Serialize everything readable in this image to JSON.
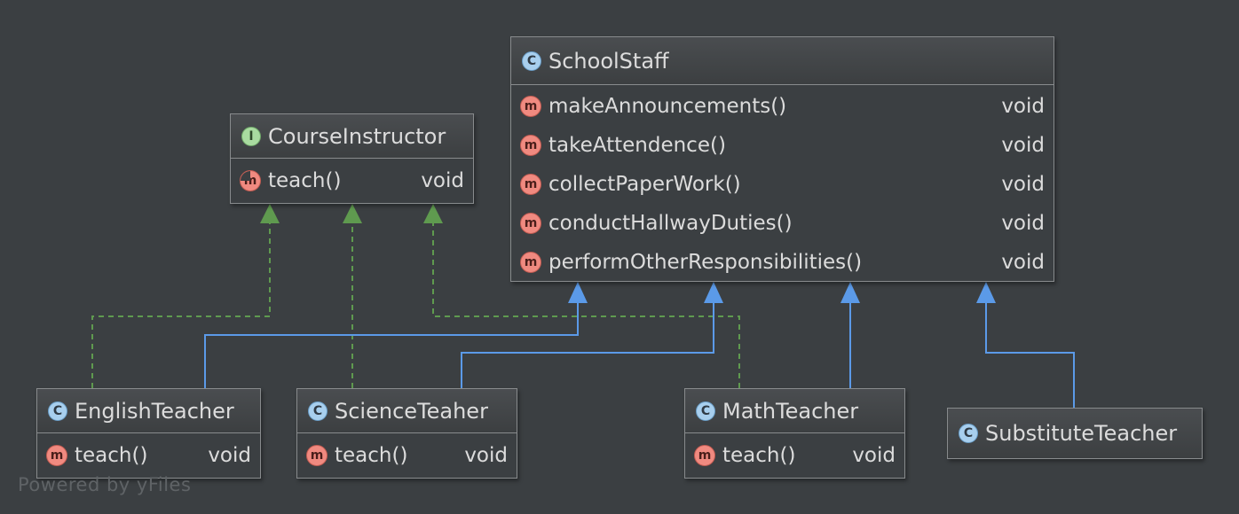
{
  "diagram": {
    "nodes": [
      {
        "id": "course-instructor",
        "kind": "interface",
        "badge": "I",
        "name": "CourseInstructor",
        "members": [
          {
            "badge": "m",
            "abstract": true,
            "name": "teach()",
            "type": "void"
          }
        ]
      },
      {
        "id": "school-staff",
        "kind": "class",
        "badge": "C",
        "name": "SchoolStaff",
        "members": [
          {
            "badge": "m",
            "name": "makeAnnouncements()",
            "type": "void"
          },
          {
            "badge": "m",
            "name": "takeAttendence()",
            "type": "void"
          },
          {
            "badge": "m",
            "name": "collectPaperWork()",
            "type": "void"
          },
          {
            "badge": "m",
            "name": "conductHallwayDuties()",
            "type": "void"
          },
          {
            "badge": "m",
            "name": "performOtherResponsibilities()",
            "type": "void"
          }
        ]
      },
      {
        "id": "english-teacher",
        "kind": "class",
        "badge": "C",
        "name": "EnglishTeacher",
        "members": [
          {
            "badge": "m",
            "name": "teach()",
            "type": "void"
          }
        ]
      },
      {
        "id": "science-teaher",
        "kind": "class",
        "badge": "C",
        "name": "ScienceTeaher",
        "members": [
          {
            "badge": "m",
            "name": "teach()",
            "type": "void"
          }
        ]
      },
      {
        "id": "math-teacher",
        "kind": "class",
        "badge": "C",
        "name": "MathTeacher",
        "members": [
          {
            "badge": "m",
            "name": "teach()",
            "type": "void"
          }
        ]
      },
      {
        "id": "substitute-teacher",
        "kind": "class",
        "badge": "C",
        "name": "SubstituteTeacher",
        "members": []
      }
    ],
    "edges": [
      {
        "from": "english-teacher",
        "to": "course-instructor",
        "type": "implements"
      },
      {
        "from": "science-teaher",
        "to": "course-instructor",
        "type": "implements"
      },
      {
        "from": "math-teacher",
        "to": "course-instructor",
        "type": "implements"
      },
      {
        "from": "english-teacher",
        "to": "school-staff",
        "type": "extends"
      },
      {
        "from": "science-teaher",
        "to": "school-staff",
        "type": "extends"
      },
      {
        "from": "math-teacher",
        "to": "school-staff",
        "type": "extends"
      },
      {
        "from": "substitute-teacher",
        "to": "school-staff",
        "type": "extends"
      }
    ],
    "colors": {
      "background": "#3b3f42",
      "extends_edge": "#5b9ae8",
      "implements_edge": "#5f9a4f"
    }
  },
  "watermark": "Powered by yFiles"
}
